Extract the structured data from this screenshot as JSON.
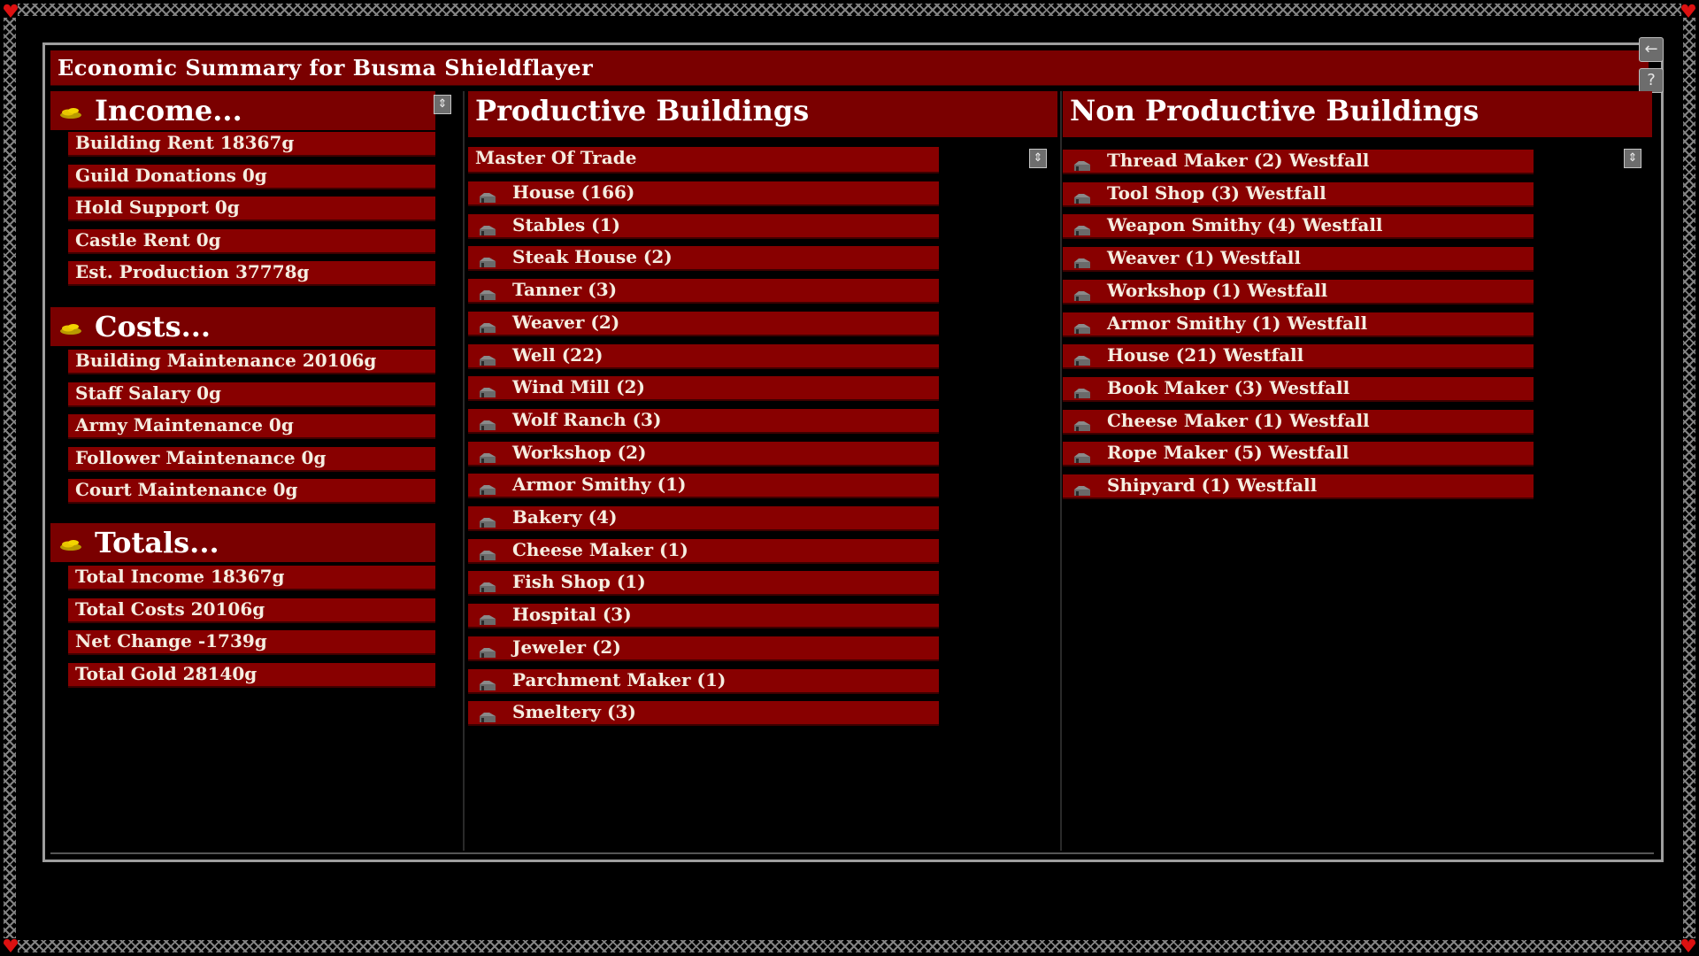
{
  "window": {
    "title": "Economic Summary for Busma Shieldflayer",
    "back_icon": "←",
    "help_icon": "?"
  },
  "left": {
    "income": {
      "header": "Income...",
      "items": [
        "Building Rent 18367g",
        "Guild Donations 0g",
        "Hold Support 0g",
        "Castle Rent 0g",
        "Est. Production 37778g"
      ]
    },
    "costs": {
      "header": "Costs...",
      "items": [
        "Building Maintenance 20106g",
        "Staff Salary 0g",
        "Army Maintenance 0g",
        "Follower Maintenance 0g",
        "Court Maintenance 0g"
      ]
    },
    "totals": {
      "header": "Totals...",
      "items": [
        "Total Income 18367g",
        "Total Costs 20106g",
        "Net Change -1739g",
        "Total Gold 28140g"
      ]
    }
  },
  "productive": {
    "header": "Productive Buildings",
    "first_row": "Master Of Trade",
    "items": [
      "House (166)",
      "Stables (1)",
      "Steak House (2)",
      "Tanner (3)",
      "Weaver (2)",
      "Well (22)",
      "Wind Mill (2)",
      "Wolf Ranch (3)",
      "Workshop (2)",
      "Armor Smithy (1)",
      "Bakery (4)",
      "Cheese Maker (1)",
      "Fish Shop (1)",
      "Hospital (3)",
      "Jeweler (2)",
      "Parchment Maker (1)",
      "Smeltery (3)"
    ]
  },
  "nonproductive": {
    "header": "Non Productive Buildings",
    "items": [
      "Thread Maker (2) Westfall",
      "Tool Shop (3) Westfall",
      "Weapon Smithy (4) Westfall",
      "Weaver (1) Westfall",
      "Workshop (1) Westfall",
      "Armor Smithy (1) Westfall",
      "House (21) Westfall",
      "Book Maker (3) Westfall",
      "Cheese Maker (1) Westfall",
      "Rope Maker (5) Westfall",
      "Shipyard (1) Westfall"
    ]
  },
  "icons": {
    "coin": "gold-coins-icon",
    "building": "building-icon",
    "scroll": "scroll-arrows-icon"
  },
  "colors": {
    "header_red": "#7a0000",
    "row_red": "#880000",
    "coin_gold": "#e8c600"
  }
}
